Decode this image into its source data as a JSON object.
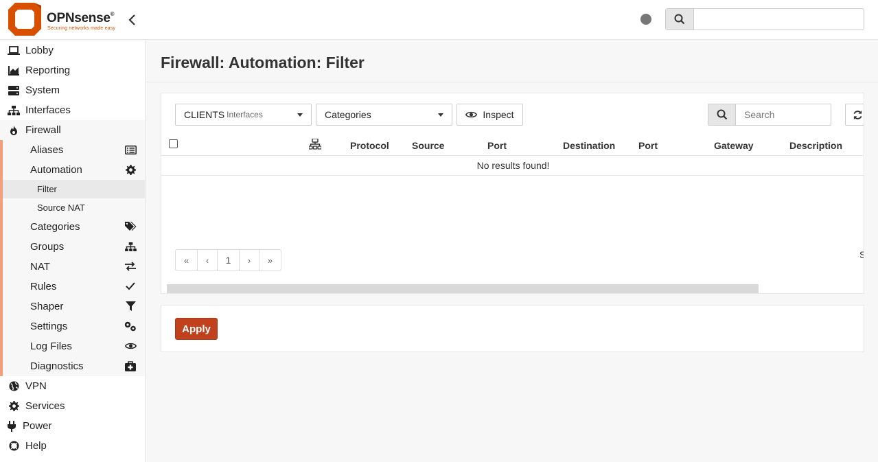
{
  "header": {
    "brand": "OPNsense",
    "brand_mark": "®",
    "tagline": "Securing networks made easy",
    "search_value": ""
  },
  "sidebar": {
    "items_top": [
      {
        "label": "Lobby",
        "icon": "laptop-icon"
      },
      {
        "label": "Reporting",
        "icon": "area-chart-icon"
      },
      {
        "label": "System",
        "icon": "server-icon"
      },
      {
        "label": "Interfaces",
        "icon": "sitemap-icon"
      }
    ],
    "firewall": {
      "label": "Firewall",
      "icon": "fire-icon",
      "children": [
        {
          "label": "Aliases",
          "icon": "list-alt-icon"
        },
        {
          "label": "Automation",
          "icon": "cog-icon",
          "children": [
            {
              "label": "Filter",
              "active": true
            },
            {
              "label": "Source NAT"
            }
          ]
        },
        {
          "label": "Categories",
          "icon": "tags-icon"
        },
        {
          "label": "Groups",
          "icon": "sitemap-icon"
        },
        {
          "label": "NAT",
          "icon": "exchange-icon"
        },
        {
          "label": "Rules",
          "icon": "check-icon"
        },
        {
          "label": "Shaper",
          "icon": "filter-icon"
        },
        {
          "label": "Settings",
          "icon": "cogs-icon"
        },
        {
          "label": "Log Files",
          "icon": "eye-icon"
        },
        {
          "label": "Diagnostics",
          "icon": "medkit-icon"
        }
      ]
    },
    "items_bottom": [
      {
        "label": "VPN",
        "icon": "globe-icon"
      },
      {
        "label": "Services",
        "icon": "cog-icon"
      },
      {
        "label": "Power",
        "icon": "plug-icon"
      },
      {
        "label": "Help",
        "icon": "life-ring-icon"
      }
    ]
  },
  "page": {
    "title": "Firewall: Automation: Filter"
  },
  "toolbar": {
    "interface_label": "CLIENTS",
    "interface_sub": "Interfaces",
    "categories_label": "Categories",
    "inspect_label": "Inspect",
    "search_placeholder": "Search"
  },
  "table": {
    "columns": [
      "Protocol",
      "Source",
      "Port",
      "Destination",
      "Port",
      "Gateway",
      "Description"
    ],
    "empty_message": "No results found!"
  },
  "pagination": {
    "first": "«",
    "prev": "‹",
    "page": "1",
    "next": "›",
    "last": "»",
    "truncated_text": "S"
  },
  "actions": {
    "apply_label": "Apply"
  },
  "colors": {
    "brand": "#d94f00",
    "apply": "#c1411c"
  }
}
